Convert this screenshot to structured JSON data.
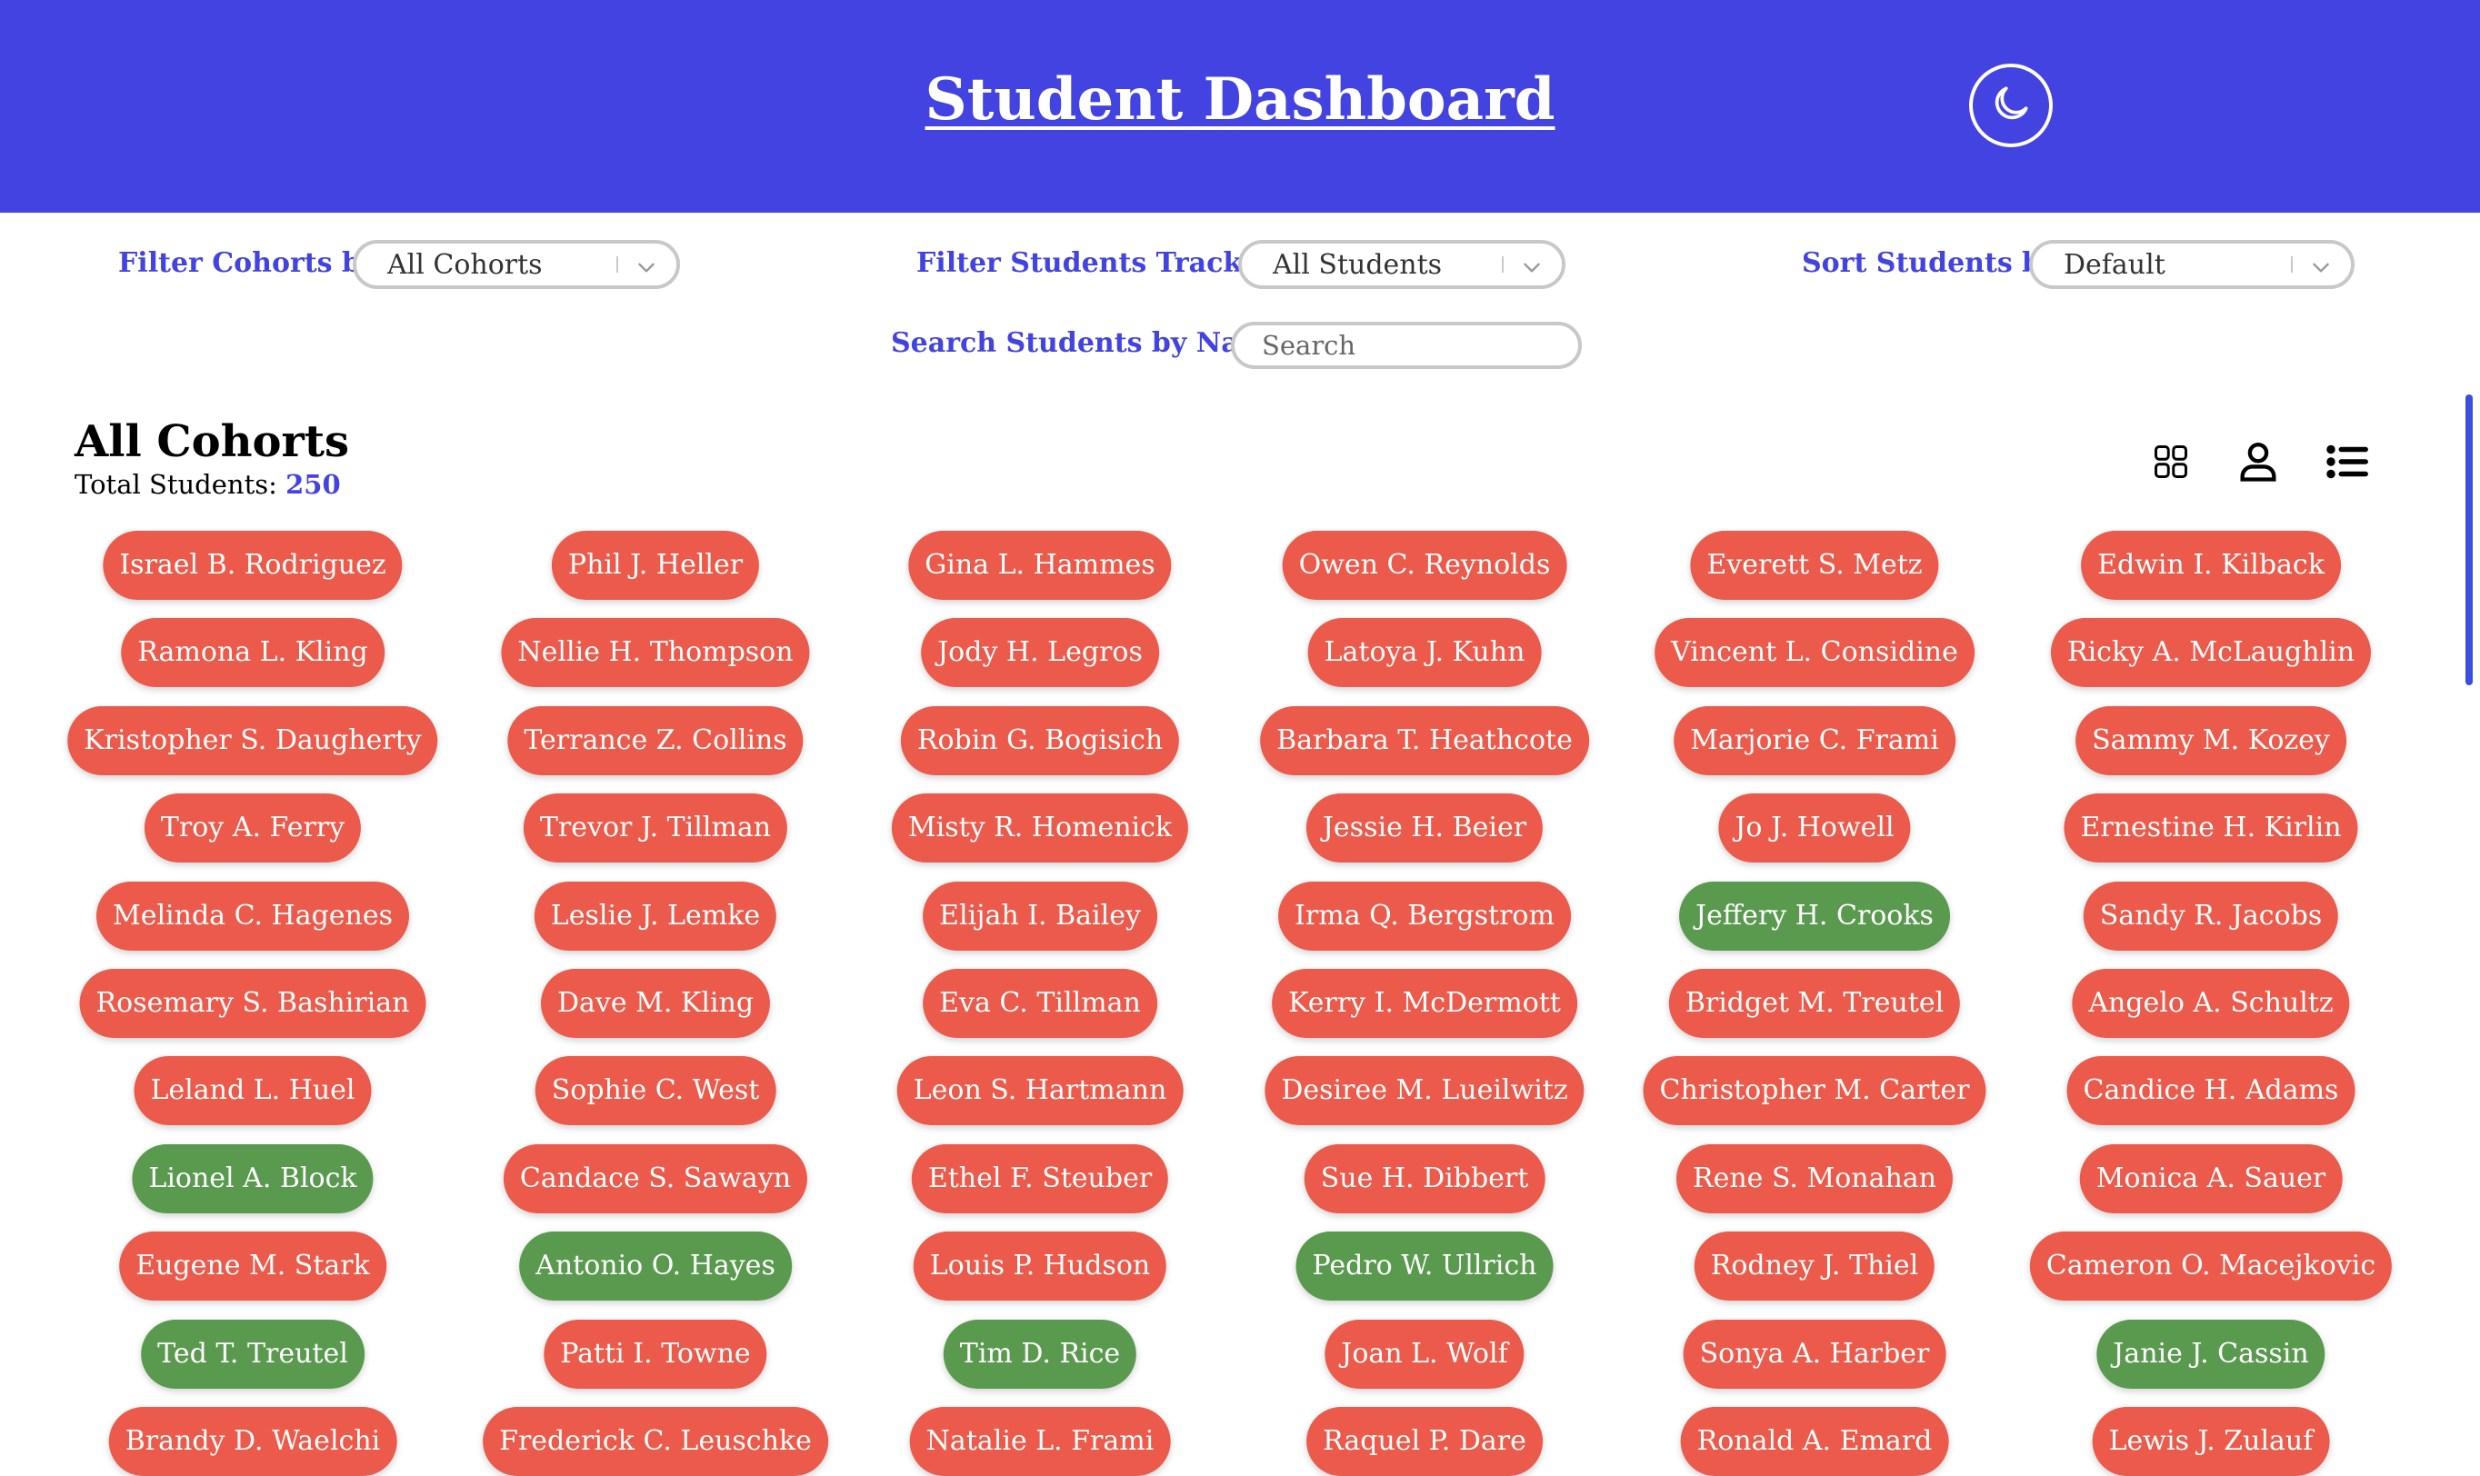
{
  "header": {
    "title": "Student Dashboard",
    "theme_icon": "moon-icon"
  },
  "filters": {
    "cohort_label": "Filter Cohorts by:",
    "cohort_value": "All Cohorts",
    "track_label": "Filter Students Track by:",
    "track_value": "All Students",
    "sort_label": "Sort Students by:",
    "sort_value": "Default",
    "search_label": "Search Students by Name:",
    "search_placeholder": "Search"
  },
  "section": {
    "title": "All Cohorts",
    "total_label": "Total Students:",
    "total_count": "250"
  },
  "view_icons": [
    "grid-view-icon",
    "user-view-icon",
    "list-view-icon"
  ],
  "colors": {
    "header": "#4343e1",
    "accent": "#4343e1",
    "off_track": "#eb5a4a",
    "on_track": "#5a9a4f"
  },
  "students": [
    [
      {
        "name": "Israel B. Rodriguez",
        "on_track": false
      },
      {
        "name": "Ramona L. Kling",
        "on_track": false
      },
      {
        "name": "Kristopher S. Daugherty",
        "on_track": false
      },
      {
        "name": "Troy A. Ferry",
        "on_track": false
      },
      {
        "name": "Melinda C. Hagenes",
        "on_track": false
      },
      {
        "name": "Rosemary S. Bashirian",
        "on_track": false
      },
      {
        "name": "Leland L. Huel",
        "on_track": false
      },
      {
        "name": "Lionel A. Block",
        "on_track": true
      },
      {
        "name": "Eugene M. Stark",
        "on_track": false
      },
      {
        "name": "Ted T. Treutel",
        "on_track": true
      },
      {
        "name": "Brandy D. Waelchi",
        "on_track": false
      }
    ],
    [
      {
        "name": "Phil J. Heller",
        "on_track": false
      },
      {
        "name": "Nellie H. Thompson",
        "on_track": false
      },
      {
        "name": "Terrance Z. Collins",
        "on_track": false
      },
      {
        "name": "Trevor J. Tillman",
        "on_track": false
      },
      {
        "name": "Leslie J. Lemke",
        "on_track": false
      },
      {
        "name": "Dave M. Kling",
        "on_track": false
      },
      {
        "name": "Sophie C. West",
        "on_track": false
      },
      {
        "name": "Candace S. Sawayn",
        "on_track": false
      },
      {
        "name": "Antonio O. Hayes",
        "on_track": true
      },
      {
        "name": "Patti I. Towne",
        "on_track": false
      },
      {
        "name": "Frederick C. Leuschke",
        "on_track": false
      }
    ],
    [
      {
        "name": "Gina L. Hammes",
        "on_track": false
      },
      {
        "name": "Jody H. Legros",
        "on_track": false
      },
      {
        "name": "Robin G. Bogisich",
        "on_track": false
      },
      {
        "name": "Misty R. Homenick",
        "on_track": false
      },
      {
        "name": "Elijah I. Bailey",
        "on_track": false
      },
      {
        "name": "Eva C. Tillman",
        "on_track": false
      },
      {
        "name": "Leon S. Hartmann",
        "on_track": false
      },
      {
        "name": "Ethel F. Steuber",
        "on_track": false
      },
      {
        "name": "Louis P. Hudson",
        "on_track": false
      },
      {
        "name": "Tim D. Rice",
        "on_track": true
      },
      {
        "name": "Natalie L. Frami",
        "on_track": false
      }
    ],
    [
      {
        "name": "Owen C. Reynolds",
        "on_track": false
      },
      {
        "name": "Latoya J. Kuhn",
        "on_track": false
      },
      {
        "name": "Barbara T. Heathcote",
        "on_track": false
      },
      {
        "name": "Jessie H. Beier",
        "on_track": false
      },
      {
        "name": "Irma Q. Bergstrom",
        "on_track": false
      },
      {
        "name": "Kerry I. McDermott",
        "on_track": false
      },
      {
        "name": "Desiree M. Lueilwitz",
        "on_track": false
      },
      {
        "name": "Sue H. Dibbert",
        "on_track": false
      },
      {
        "name": "Pedro W. Ullrich",
        "on_track": true
      },
      {
        "name": "Joan L. Wolf",
        "on_track": false
      },
      {
        "name": "Raquel P. Dare",
        "on_track": false
      }
    ],
    [
      {
        "name": "Everett S. Metz",
        "on_track": false
      },
      {
        "name": "Vincent L. Considine",
        "on_track": false
      },
      {
        "name": "Marjorie C. Frami",
        "on_track": false
      },
      {
        "name": "Jo J. Howell",
        "on_track": false
      },
      {
        "name": "Jeffery H. Crooks",
        "on_track": true
      },
      {
        "name": "Bridget M. Treutel",
        "on_track": false
      },
      {
        "name": "Christopher M. Carter",
        "on_track": false
      },
      {
        "name": "Rene S. Monahan",
        "on_track": false
      },
      {
        "name": "Rodney J. Thiel",
        "on_track": false
      },
      {
        "name": "Sonya A. Harber",
        "on_track": false
      },
      {
        "name": "Ronald A. Emard",
        "on_track": false
      }
    ],
    [
      {
        "name": "Edwin I. Kilback",
        "on_track": false
      },
      {
        "name": "Ricky A. McLaughlin",
        "on_track": false
      },
      {
        "name": "Sammy M. Kozey",
        "on_track": false
      },
      {
        "name": "Ernestine H. Kirlin",
        "on_track": false
      },
      {
        "name": "Sandy R. Jacobs",
        "on_track": false
      },
      {
        "name": "Angelo A. Schultz",
        "on_track": false
      },
      {
        "name": "Candice H. Adams",
        "on_track": false
      },
      {
        "name": "Monica A. Sauer",
        "on_track": false
      },
      {
        "name": "Cameron O. Macejkovic",
        "on_track": false
      },
      {
        "name": "Janie J. Cassin",
        "on_track": true
      },
      {
        "name": "Lewis J. Zulauf",
        "on_track": false
      }
    ]
  ]
}
